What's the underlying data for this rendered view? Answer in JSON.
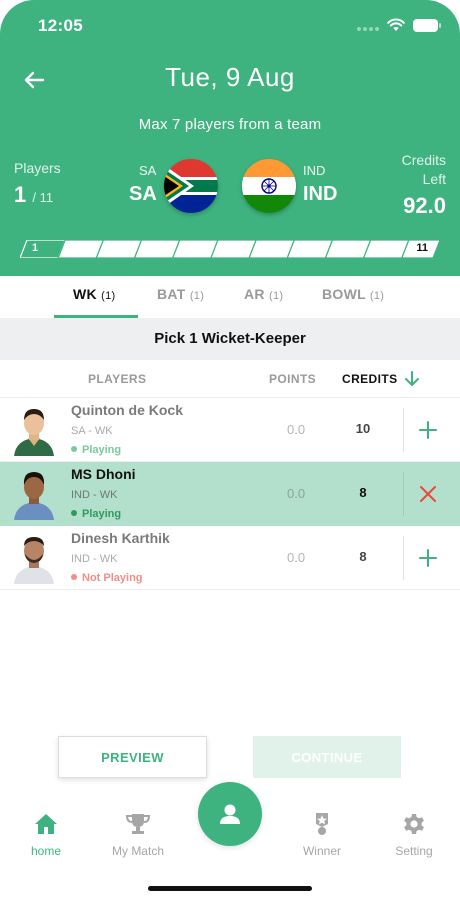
{
  "status_bar": {
    "time": "12:05"
  },
  "header": {
    "title": "Tue, 9 Aug",
    "subtitle": "Max 7 players from a team",
    "players_label": "Players",
    "players_selected": "1",
    "players_total": "/ 11",
    "team_a": {
      "short": "SA",
      "name": "SA",
      "flag": "south-africa-flag"
    },
    "team_b": {
      "short": "IND",
      "name": "IND",
      "flag": "india-flag"
    },
    "credits_label_line1": "Credits",
    "credits_label_line2": "Left",
    "credits_left": "92.0",
    "progress": {
      "filled": 1,
      "total": 11,
      "start_label": "1",
      "end_label": "11"
    }
  },
  "tabs": [
    {
      "label": "WK",
      "count": "(1)",
      "active": true
    },
    {
      "label": "BAT",
      "count": "(1)",
      "active": false
    },
    {
      "label": "AR",
      "count": "(1)",
      "active": false
    },
    {
      "label": "BOWL",
      "count": "(1)",
      "active": false
    }
  ],
  "pick_instruction": "Pick 1 Wicket-Keeper",
  "columns": {
    "players": "PLAYERS",
    "points": "POINTS",
    "credits": "CREDITS"
  },
  "players": [
    {
      "name": "Quinton de Kock",
      "meta": "SA - WK",
      "status": "Playing",
      "points": "0.0",
      "credits": "10",
      "selected": false
    },
    {
      "name": "MS Dhoni",
      "meta": "IND - WK",
      "status": "Playing",
      "points": "0.0",
      "credits": "8",
      "selected": true
    },
    {
      "name": "Dinesh Karthik",
      "meta": "IND - WK",
      "status": "Not Playing",
      "points": "0.0",
      "credits": "8",
      "selected": false
    }
  ],
  "buttons": {
    "preview": "PREVIEW",
    "continue": "CONTINUE"
  },
  "nav": [
    {
      "label": "home",
      "icon": "home-icon",
      "active": true
    },
    {
      "label": "My Match",
      "icon": "trophy-icon",
      "active": false
    },
    {
      "label": "Winner",
      "icon": "medal-icon",
      "active": false
    },
    {
      "label": "Setting",
      "icon": "gear-icon",
      "active": false
    }
  ],
  "colors": {
    "primary": "#3fb37f",
    "selected_row": "#b3e0cc",
    "remove": "#e8493e",
    "not_playing": "#ef8f86"
  }
}
